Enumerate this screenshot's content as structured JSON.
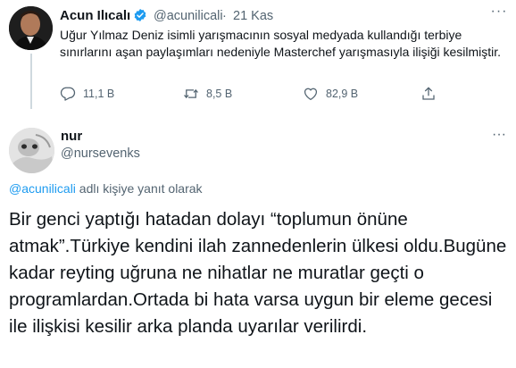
{
  "original_tweet": {
    "author_name": "Acun Ilıcalı",
    "handle": "@acunilicali",
    "separator": "·",
    "time": "21 Kas",
    "more_glyph": "···",
    "text": "Uğur Yılmaz Deniz isimli yarışmacının sosyal medyada kullandığı terbiye sınırlarını aşan paylaşımları nedeniyle Masterchef yarışmasıyla ilişiği kesilmiştir.",
    "actions": {
      "reply_count": "11,1 B",
      "retweet_count": "8,5 B",
      "like_count": "82,9 B"
    },
    "icons": [
      "verified-badge-icon",
      "reply-icon",
      "retweet-icon",
      "like-icon",
      "share-icon"
    ],
    "accent_color": "#1d9bf0"
  },
  "reply_tweet": {
    "author_name": "nur",
    "handle": "@nursevenks",
    "more_glyph": "···",
    "replying_mention": "@acunilicali",
    "replying_suffix": " adlı kişiye yanıt olarak",
    "text": "Bir genci yaptığı hatadan dolayı “toplumun önüne atmak”.Türkiye kendini ilah zannedenlerin ülkesi oldu.Bugüne kadar reyting uğruna ne nihatlar ne muratlar geçti o programlardan.Ortada bi hata varsa uygun bir eleme gecesi ile ilişkisi kesilir arka planda uyarılar verilirdi."
  }
}
